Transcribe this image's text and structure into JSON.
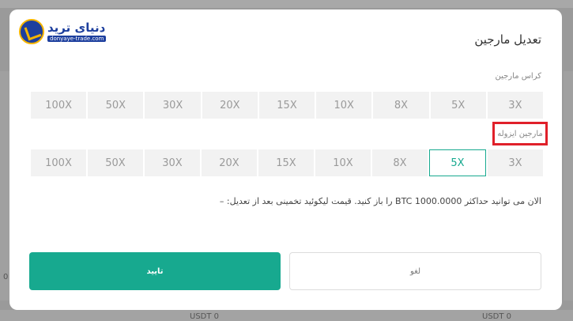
{
  "logo": {
    "name": "دنیای ترید",
    "subtitle": "donyaye-trade.com"
  },
  "modal": {
    "title": "تعدیل مارجین",
    "cross_label": "کراس مارجین",
    "isolated_label": "مارجین ایزوله",
    "cross_options": [
      "3X",
      "5X",
      "8X",
      "10X",
      "15X",
      "20X",
      "30X",
      "50X",
      "100X"
    ],
    "isolated_options": [
      "3X",
      "5X",
      "8X",
      "10X",
      "15X",
      "20X",
      "30X",
      "50X",
      "100X"
    ],
    "isolated_selected": "5X",
    "info_text": "الان می توانید حداکثر BTC 1000.0000 را باز کنید. قیمت لیکوئید تخمینی بعد از تعدیل: –",
    "confirm_label": "تایید",
    "cancel_label": "لغو"
  },
  "background": {
    "left_value": "0",
    "bottom_text_left": "USDT 0",
    "bottom_text_right": "USDT 0"
  },
  "colors": {
    "accent": "#17a98f",
    "highlight_border": "#e0202a",
    "logo_blue": "#1d3f9e",
    "logo_gold": "#f4b400"
  }
}
